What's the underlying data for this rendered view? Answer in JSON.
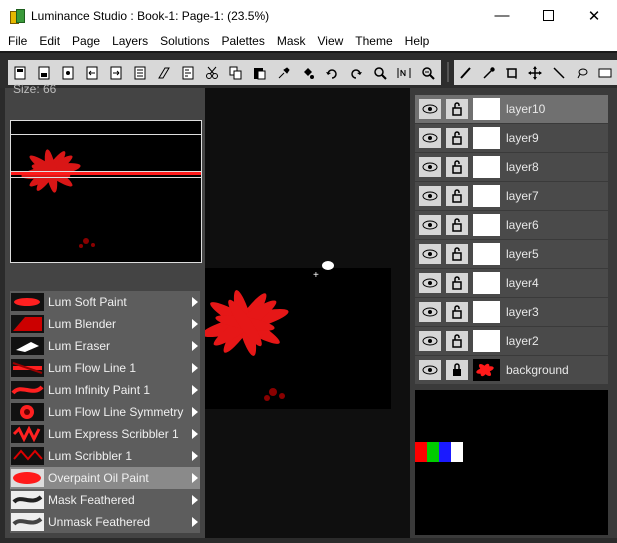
{
  "window": {
    "title": "Luminance Studio : Book-1: Page-1:  (23.5%)",
    "minimize": "—",
    "close": "✕"
  },
  "menu": [
    "File",
    "Edit",
    "Page",
    "Layers",
    "Solutions",
    "Palettes",
    "Mask",
    "View",
    "Theme",
    "Help"
  ],
  "toolbar": {
    "file_tools": [
      "new-icon",
      "save-icon",
      "open-icon",
      "import-icon",
      "export-icon",
      "print-icon",
      "gradient-icon",
      "script-icon",
      "cut-icon",
      "copy-icon",
      "paste-icon",
      "pick-icon",
      "fill-icon",
      "undo-icon",
      "redo-icon",
      "zoom-in-icon",
      "actual-size-icon",
      "zoom-out-icon"
    ],
    "draw_tools": [
      "brush-icon",
      "eyedropper-icon",
      "crop-icon",
      "move-icon",
      "line-icon",
      "lasso-icon",
      "rect-icon"
    ]
  },
  "left_panel": {
    "size_label": "Size: 66",
    "brushes": [
      {
        "label": "Lum Soft Paint",
        "selected": false
      },
      {
        "label": "Lum Blender",
        "selected": false
      },
      {
        "label": "Lum Eraser",
        "selected": false
      },
      {
        "label": "Lum Flow Line 1",
        "selected": false
      },
      {
        "label": "Lum Infinity Paint 1",
        "selected": false
      },
      {
        "label": "Lum Flow Line Symmetry",
        "selected": false
      },
      {
        "label": "Lum Express Scribbler 1",
        "selected": false
      },
      {
        "label": "Lum Scribbler 1",
        "selected": false
      },
      {
        "label": "Overpaint Oil Paint",
        "selected": true
      },
      {
        "label": "Mask Feathered",
        "selected": false
      },
      {
        "label": "Unmask Feathered",
        "selected": false
      }
    ]
  },
  "layers": [
    {
      "name": "layer10",
      "active": true
    },
    {
      "name": "layer9",
      "active": false
    },
    {
      "name": "layer8",
      "active": false
    },
    {
      "name": "layer7",
      "active": false
    },
    {
      "name": "layer6",
      "active": false
    },
    {
      "name": "layer5",
      "active": false
    },
    {
      "name": "layer4",
      "active": false
    },
    {
      "name": "layer3",
      "active": false
    },
    {
      "name": "layer2",
      "active": false
    },
    {
      "name": "background",
      "active": false
    }
  ],
  "colors": {
    "accent_red": "#ff1a1a",
    "swatches": [
      "#ff0000",
      "#00cc00",
      "#1a1aff",
      "#ffffff"
    ]
  }
}
